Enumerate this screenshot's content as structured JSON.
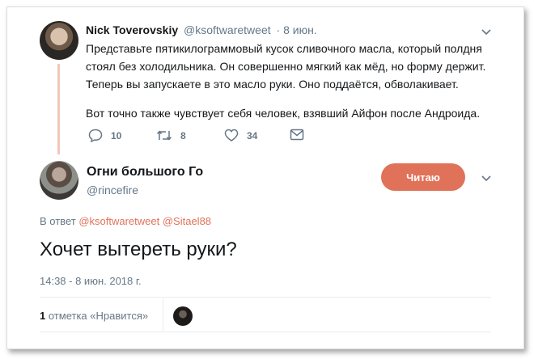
{
  "parent_tweet": {
    "author_name": "Nick Toverovskiy",
    "handle": "@ksoftwaretweet",
    "date": "· 8 июн.",
    "lines": [
      "Представьте пятикилограммовый кусок сливочного масла, который полдня",
      "стоял без холодильника. Он совершенно мягкий как мёд, но форму держит.",
      "Теперь вы запускаете в это масло руки. Оно поддаётся, обволакивает.",
      "Вот точно также чувствует себя человек, взявший Айфон после Андроида."
    ],
    "actions": {
      "replies": "10",
      "retweets": "8",
      "likes": "34"
    }
  },
  "tweet": {
    "author_name": "Огни большого Го",
    "handle": "@rincefire",
    "follow_label": "Читаю",
    "reply_prefix": "В ответ",
    "reply_mentions": [
      "@ksoftwaretweet",
      "@Sitael88"
    ],
    "text": "Хочет вытереть руки?",
    "timestamp": "14:38 - 8 июн. 2018 г.",
    "likes_count": "1",
    "likes_label": "отметка «Нравится»"
  },
  "colors": {
    "accent": "#e0725a",
    "thread_line": "#f1c7b8",
    "muted_text": "#657786",
    "primary_text": "#14171a"
  },
  "icons": {
    "reply": "reply-icon",
    "retweet": "retweet-icon",
    "like": "heart-icon",
    "dm": "envelope-icon",
    "more": "chevron-down-icon"
  }
}
